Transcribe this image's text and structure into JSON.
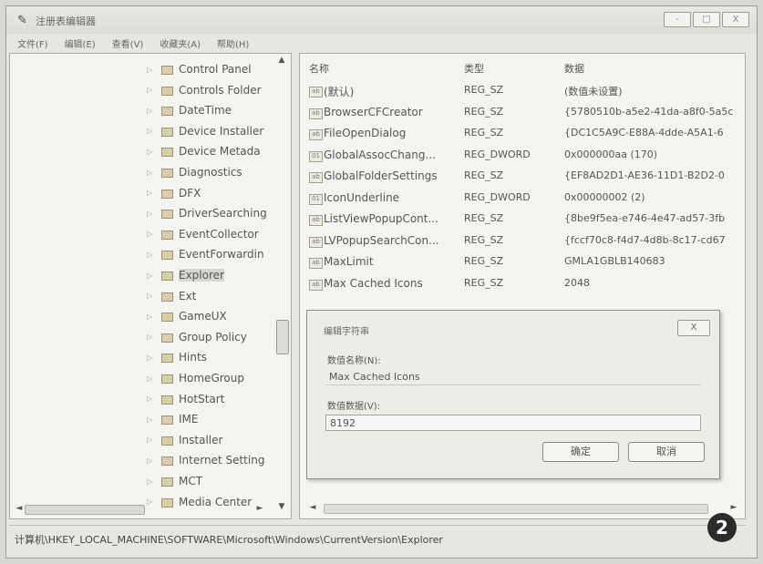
{
  "window": {
    "title": "注册表编辑器",
    "controls": {
      "minimize": "-",
      "maximize": "□",
      "close": "X"
    }
  },
  "menu": [
    "文件(F)",
    "编辑(E)",
    "查看(V)",
    "收藏夹(A)",
    "帮助(H)"
  ],
  "tree": {
    "items": [
      {
        "label": "Control Panel"
      },
      {
        "label": "Controls Folder"
      },
      {
        "label": "DateTime"
      },
      {
        "label": "Device Installer"
      },
      {
        "label": "Device Metada"
      },
      {
        "label": "Diagnostics"
      },
      {
        "label": "DFX"
      },
      {
        "label": "DriverSearching"
      },
      {
        "label": "EventCollector"
      },
      {
        "label": "EventForwardin"
      },
      {
        "label": "Explorer"
      },
      {
        "label": "Ext"
      },
      {
        "label": "GameUX"
      },
      {
        "label": "Group Policy"
      },
      {
        "label": "Hints"
      },
      {
        "label": "HomeGroup"
      },
      {
        "label": "HotStart"
      },
      {
        "label": "IME"
      },
      {
        "label": "Installer"
      },
      {
        "label": "Internet Setting"
      },
      {
        "label": "MCT"
      },
      {
        "label": "Media Center"
      }
    ]
  },
  "values": {
    "headers": {
      "name": "名称",
      "type": "类型",
      "data": "数据"
    },
    "rows": [
      {
        "name": "(默认)",
        "type": "REG_SZ",
        "data": "(数值未设置)",
        "icon": "ab"
      },
      {
        "name": "BrowserCFCreator",
        "type": "REG_SZ",
        "data": "{5780510b-a5e2-41da-a8f0-5a5c",
        "icon": "ab"
      },
      {
        "name": "FileOpenDialog",
        "type": "REG_SZ",
        "data": "{DC1C5A9C-E88A-4dde-A5A1-6",
        "icon": "ab"
      },
      {
        "name": "GlobalAssocChang...",
        "type": "REG_DWORD",
        "data": "0x000000aa (170)",
        "icon": "01"
      },
      {
        "name": "GlobalFolderSettings",
        "type": "REG_SZ",
        "data": "{EF8AD2D1-AE36-11D1-B2D2-0",
        "icon": "ab"
      },
      {
        "name": "IconUnderline",
        "type": "REG_DWORD",
        "data": "0x00000002 (2)",
        "icon": "01"
      },
      {
        "name": "ListViewPopupCont...",
        "type": "REG_SZ",
        "data": "{8be9f5ea-e746-4e47-ad57-3fb",
        "icon": "ab"
      },
      {
        "name": "LVPopupSearchCon...",
        "type": "REG_SZ",
        "data": "{fccf70c8-f4d7-4d8b-8c17-cd67",
        "icon": "ab"
      },
      {
        "name": "MaxLimit",
        "type": "REG_SZ",
        "data": "GMLA1GBLB140683",
        "icon": "ab"
      },
      {
        "name": "Max Cached Icons",
        "type": "REG_SZ",
        "data": "2048",
        "icon": "ab"
      }
    ]
  },
  "dialog": {
    "title": "编辑字符串",
    "close": "X",
    "name_label": "数值名称(N):",
    "name_value": "Max Cached Icons",
    "data_label": "数值数据(V):",
    "data_value": "8192",
    "ok": "确定",
    "cancel": "取消"
  },
  "status": {
    "path": "计算机\\HKEY_LOCAL_MACHINE\\SOFTWARE\\Microsoft\\Windows\\CurrentVersion\\Explorer"
  },
  "badge": "2"
}
